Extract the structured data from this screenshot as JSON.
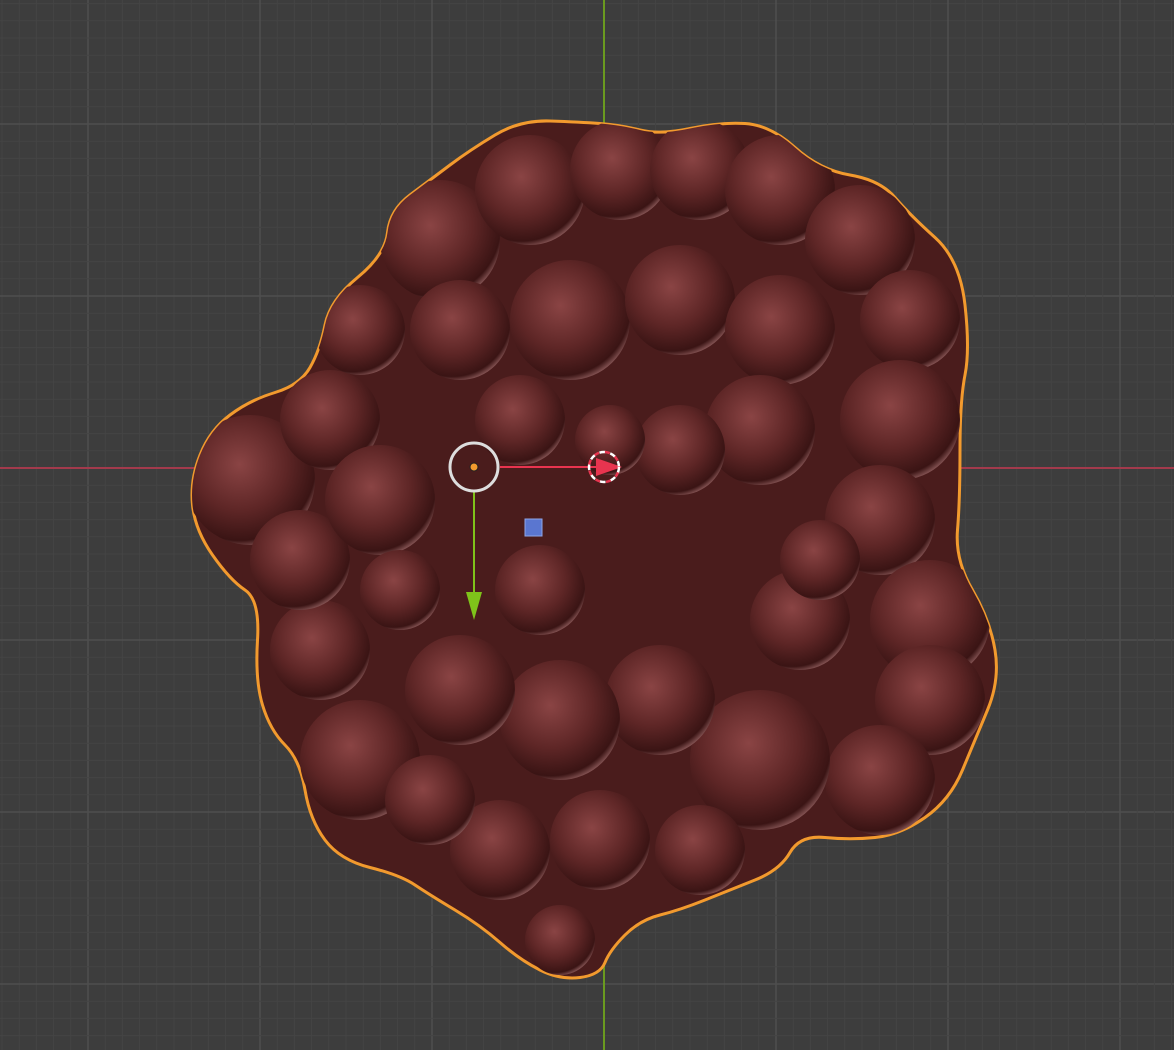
{
  "viewport": {
    "background_color": "#3d3d3d",
    "grid_minor_color": "#444444",
    "grid_major_color": "#4f4f4f",
    "x_axis_color": "#a33a4c",
    "y_axis_color": "#6a9a1f"
  },
  "object": {
    "name_icon": "metaball-blob",
    "base_color": "#5a2323",
    "highlight_color": "#a06060",
    "selection_outline_color": "#f29a2e"
  },
  "gizmo": {
    "x_arrow_color": "#e8344f",
    "y_arrow_color": "#7fc31a",
    "plane_handle_color": "#5a76d0",
    "ring_color": "#dddddd",
    "origin_color": "#f29a2e"
  }
}
